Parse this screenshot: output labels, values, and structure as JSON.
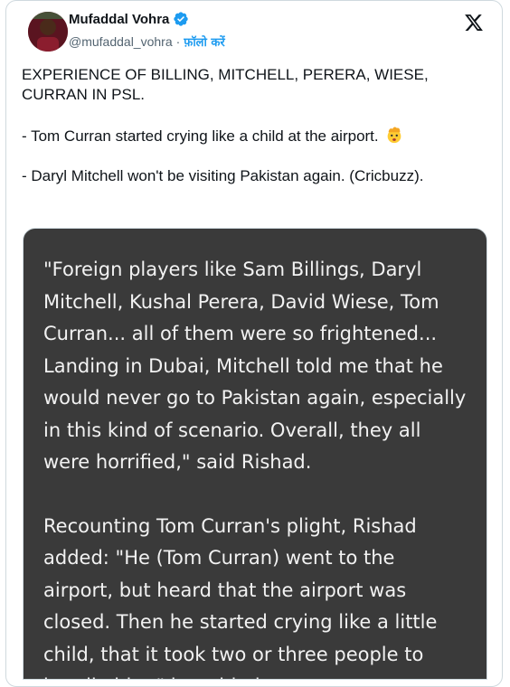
{
  "author": {
    "display_name": "Mufaddal Vohra",
    "handle": "@mufaddal_vohra",
    "separator": "·",
    "follow_label": "फ़ॉलो करें",
    "avatar_icon": "user-avatar-icon",
    "verified_icon": "verified-badge-icon"
  },
  "brand": {
    "logo_icon": "x-logo-icon"
  },
  "tweet": {
    "line1": "EXPERIENCE OF BILLING, MITCHELL, PERERA, WIESE, CURRAN IN PSL.",
    "line2": "- Tom Curran started crying like a child at the airport.",
    "line2_emoji": "exploding-head-emoji",
    "line3": "- Daryl Mitchell won't be visiting Pakistan again. (Cricbuzz)."
  },
  "media": {
    "paragraph1": "\"Foreign players like Sam Billings, Daryl Mitchell, Kushal Perera, David Wiese, Tom Curran... all of them were so frightened... Landing in Dubai, Mitchell told me that he would never go to Pakistan again, especially in this kind of scenario. Overall, they all were horrified,\" said Rishad.",
    "paragraph2": "Recounting Tom Curran's plight, Rishad added: \"He (Tom Curran) went to the airport, but heard that the airport was closed. Then he started crying like a little child, that it took two or three people to handle him,\" he added."
  },
  "colors": {
    "accent": "#1d9bf0",
    "text": "#0f1419",
    "muted": "#536471",
    "media_bg": "#3a3a3a",
    "media_text": "#f2f2f2"
  }
}
